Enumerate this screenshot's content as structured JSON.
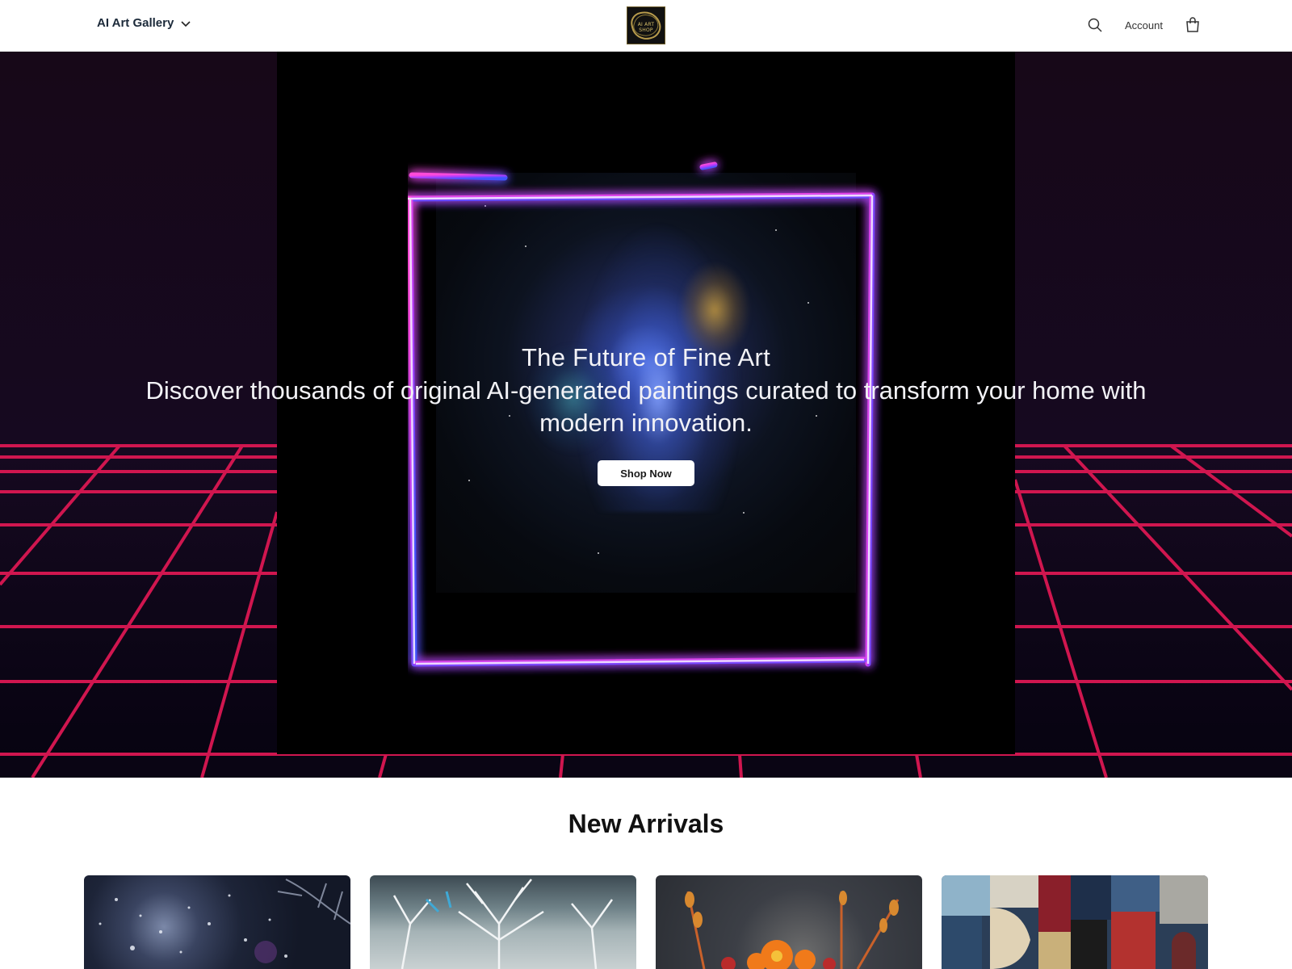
{
  "header": {
    "menu_label": "AI Art Gallery",
    "logo_text": "AI ART SHOP",
    "account_label": "Account",
    "icons": [
      "search-icon",
      "bag-icon",
      "chevron-down-icon"
    ]
  },
  "hero": {
    "title": "The Future of Fine Art",
    "subtitle": "Discover thousands of original AI-generated paintings curated to transform your home with modern innovation.",
    "cta_label": "Shop Now",
    "colors": {
      "grid": "#d0164f",
      "neon_pink": "#e24bff",
      "neon_blue": "#4a5cff",
      "background": "#120716"
    }
  },
  "new_arrivals": {
    "title": "New Arrivals",
    "products": [
      {
        "image": "starry-tree-painting"
      },
      {
        "image": "white-trees-painting"
      },
      {
        "image": "orange-flowers-painting"
      },
      {
        "image": "abstract-geometric-painting"
      }
    ]
  }
}
